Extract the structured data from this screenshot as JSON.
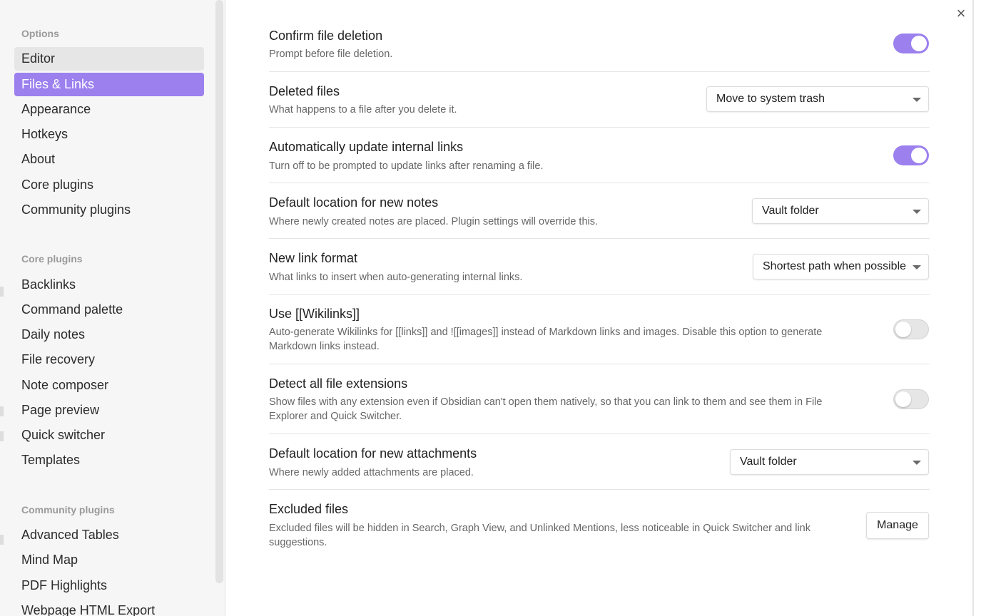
{
  "sidebar": {
    "options_heading": "Options",
    "options": [
      "Editor",
      "Files & Links",
      "Appearance",
      "Hotkeys",
      "About",
      "Core plugins",
      "Community plugins"
    ],
    "core_heading": "Core plugins",
    "core": [
      "Backlinks",
      "Command palette",
      "Daily notes",
      "File recovery",
      "Note composer",
      "Page preview",
      "Quick switcher",
      "Templates"
    ],
    "community_heading": "Community plugins",
    "community": [
      "Advanced Tables",
      "Mind Map",
      "PDF Highlights",
      "Webpage HTML Export"
    ],
    "active_item": "Files & Links",
    "hover_item": "Editor"
  },
  "close_icon": "×",
  "accent_color": "#9b80ee",
  "settings": [
    {
      "name": "Confirm file deletion",
      "desc": "Prompt before file deletion.",
      "control": "toggle",
      "on": true
    },
    {
      "name": "Deleted files",
      "desc": "What happens to a file after you delete it.",
      "control": "dropdown",
      "value": "Move to system trash"
    },
    {
      "name": "Automatically update internal links",
      "desc": "Turn off to be prompted to update links after renaming a file.",
      "control": "toggle",
      "on": true
    },
    {
      "name": "Default location for new notes",
      "desc": "Where newly created notes are placed. Plugin settings will override this.",
      "control": "dropdown",
      "value": "Vault folder"
    },
    {
      "name": "New link format",
      "desc": "What links to insert when auto-generating internal links.",
      "control": "dropdown",
      "value": "Shortest path when possible"
    },
    {
      "name": "Use [[Wikilinks]]",
      "desc": "Auto-generate Wikilinks for [[links]] and ![[images]] instead of Markdown links and images. Disable this option to generate Markdown links instead.",
      "control": "toggle",
      "on": false
    },
    {
      "name": "Detect all file extensions",
      "desc": "Show files with any extension even if Obsidian can't open them natively, so that you can link to them and see them in File Explorer and Quick Switcher.",
      "control": "toggle",
      "on": false
    },
    {
      "name": "Default location for new attachments",
      "desc": "Where newly added attachments are placed.",
      "control": "dropdown",
      "value": "Vault folder"
    },
    {
      "name": "Excluded files",
      "desc": "Excluded files will be hidden in Search, Graph View, and Unlinked Mentions, less noticeable in Quick Switcher and link suggestions.",
      "control": "button",
      "value": "Manage"
    }
  ]
}
